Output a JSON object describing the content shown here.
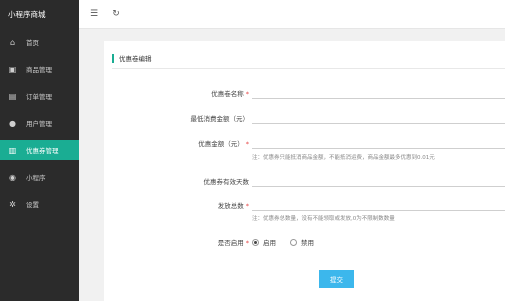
{
  "app": {
    "brand": "小程序商城"
  },
  "sidebar": {
    "items": [
      {
        "label": "首页",
        "icon": "home-icon",
        "glyph": "⌂"
      },
      {
        "label": "商品管理",
        "icon": "gift-icon",
        "glyph": "▣"
      },
      {
        "label": "订单管理",
        "icon": "list-icon",
        "glyph": "▤"
      },
      {
        "label": "用户管理",
        "icon": "user-icon",
        "glyph": "●"
      },
      {
        "label": "优惠券管理",
        "icon": "bars-icon",
        "glyph": "▥"
      },
      {
        "label": "小程序",
        "icon": "compass-icon",
        "glyph": "◉"
      },
      {
        "label": "设置",
        "icon": "gear-icon",
        "glyph": "✲"
      }
    ],
    "active_index": 4,
    "active_color": "#1aad93"
  },
  "topbar": {
    "menu_glyph": "☰",
    "refresh_glyph": "↻"
  },
  "form": {
    "title": "优惠卷编辑",
    "fields": {
      "name": {
        "label": "优惠卷名称",
        "value": ""
      },
      "min_amount": {
        "label": "最低消费金额（元）",
        "value": ""
      },
      "discount": {
        "label": "优惠金额（元）",
        "value": "",
        "hint": "注：优惠券只能抵消商品金额，不能抵消运费，商品金额最多优惠到0.01元"
      },
      "valid_days": {
        "label": "优惠券有效天数",
        "value": ""
      },
      "total": {
        "label": "发放总数",
        "value": "",
        "hint": "注：优惠券总数量，没有不能领取或发放,0为不限制数数量"
      },
      "enabled": {
        "label": "是否启用",
        "options": [
          "启用",
          "禁用"
        ],
        "selected": "启用"
      }
    },
    "submit_label": "提交",
    "submit_color": "#3cb7ec"
  }
}
